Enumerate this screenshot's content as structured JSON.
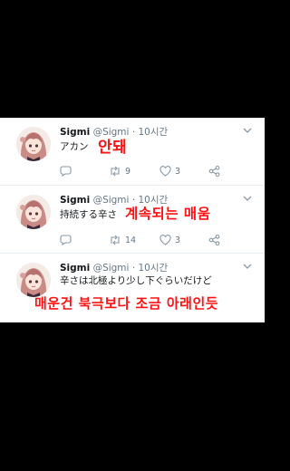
{
  "tweets": [
    {
      "name": "Sigmi",
      "handle": "@Sigmi",
      "dot": "·",
      "time": "10시간",
      "text": "アカン",
      "overlay": "안돼",
      "retweets": "9",
      "likes": "3"
    },
    {
      "name": "Sigmi",
      "handle": "@Sigmi",
      "dot": "·",
      "time": "10시간",
      "text": "持続する辛さ",
      "overlay": "계속되는 매움",
      "retweets": "14",
      "likes": "3"
    },
    {
      "name": "Sigmi",
      "handle": "@Sigmi",
      "dot": "·",
      "time": "10시간",
      "text": "辛さは北極より少し下ぐらいだけど",
      "overlay": "매운건 북극보다 조금 아래인듯"
    }
  ],
  "colors": {
    "background": "#000000",
    "panel": "#ffffff",
    "overlay_red": "#ff1212",
    "meta_gray": "#657786",
    "text": "#14171a"
  },
  "icons": [
    "reply-icon",
    "retweet-icon",
    "like-icon",
    "share-icon",
    "chevron-down-icon"
  ]
}
